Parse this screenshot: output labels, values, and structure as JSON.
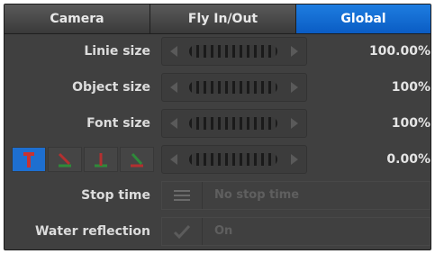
{
  "tabs": [
    {
      "label": "Camera",
      "active": false
    },
    {
      "label": "Fly In/Out",
      "active": false
    },
    {
      "label": "Global",
      "active": true
    }
  ],
  "rows": {
    "line_size": {
      "label": "Linie size",
      "value": "100.00%"
    },
    "object_size": {
      "label": "Object size",
      "value": "100%"
    },
    "font_size": {
      "label": "Font size",
      "value": "100%"
    },
    "axis_rotation": {
      "value": "0.00%",
      "axis_icons": [
        "axis-y-icon",
        "axis-xy-icon",
        "axis-xz-icon",
        "axis-yz-icon"
      ]
    },
    "stop_time": {
      "label": "Stop time",
      "value": "No stop time",
      "icon": "list-icon"
    },
    "water_reflection": {
      "label": "Water reflection",
      "value": "On",
      "icon": "checkmark-icon"
    }
  },
  "colors": {
    "panel_bg": "#404040",
    "active_tab": "#0a5cc4",
    "axis_red": "#c83232",
    "axis_green": "#2f8a3a"
  }
}
